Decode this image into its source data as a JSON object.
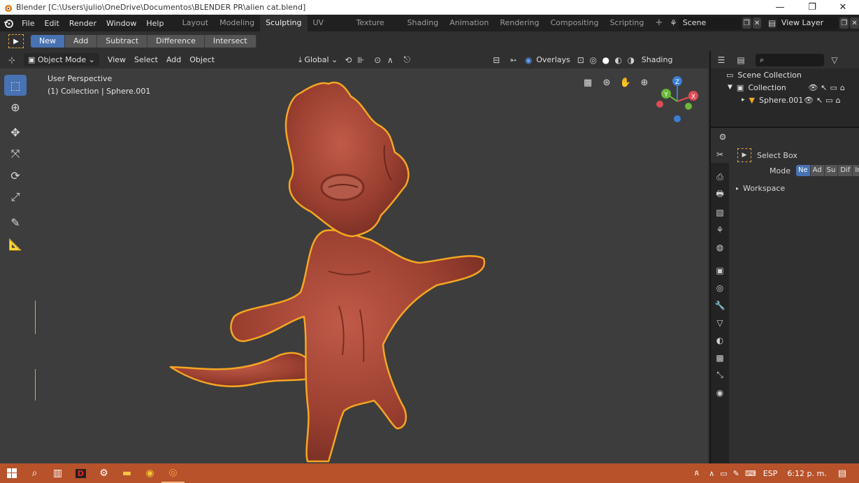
{
  "window": {
    "title": "Blender [C:\\Users\\julio\\OneDrive\\Documentos\\BLENDER PR\\alien cat.blend]",
    "minimize": "—",
    "restore": "❐",
    "close": "✕"
  },
  "menu": {
    "items": [
      "File",
      "Edit",
      "Render",
      "Window",
      "Help"
    ]
  },
  "workspaces": {
    "tabs": [
      "Layout",
      "Modeling",
      "Sculpting",
      "UV Editing",
      "Texture Paint",
      "Shading",
      "Animation",
      "Rendering",
      "Compositing",
      "Scripting"
    ],
    "active": "Sculpting",
    "add": "+"
  },
  "scene": {
    "label": "Scene",
    "view_layer": "View Layer"
  },
  "tool_settings": {
    "modes": [
      "New",
      "Add",
      "Subtract",
      "Difference",
      "Intersect"
    ],
    "active": "New"
  },
  "viewport_header": {
    "mode": "Object Mode",
    "menus": [
      "View",
      "Select",
      "Add",
      "Object"
    ],
    "orientation": "Global",
    "overlays": "Overlays",
    "shading": "Shading"
  },
  "viewport": {
    "perspective": "User Perspective",
    "collection_info": "(1) Collection | Sphere.001",
    "gizmo": {
      "z": "Z",
      "y": "Y",
      "x": "X"
    }
  },
  "outliner": {
    "scene_collection": "Scene Collection",
    "collection": "Collection",
    "object": "Sphere.001"
  },
  "properties": {
    "tool_name": "Select Box",
    "mode_label": "Mode",
    "mode_options": [
      "Ne",
      "Ad",
      "Su",
      "Dif",
      "Int"
    ],
    "mode_active": "Ne",
    "workspace_panel": "Workspace"
  },
  "taskbar": {
    "language": "ESP",
    "time": "6:12 p. m."
  },
  "colors": {
    "accent": "#4772b3",
    "taskbar": "#b7522a",
    "model": "#a8493a",
    "outline": "#f5a623"
  }
}
